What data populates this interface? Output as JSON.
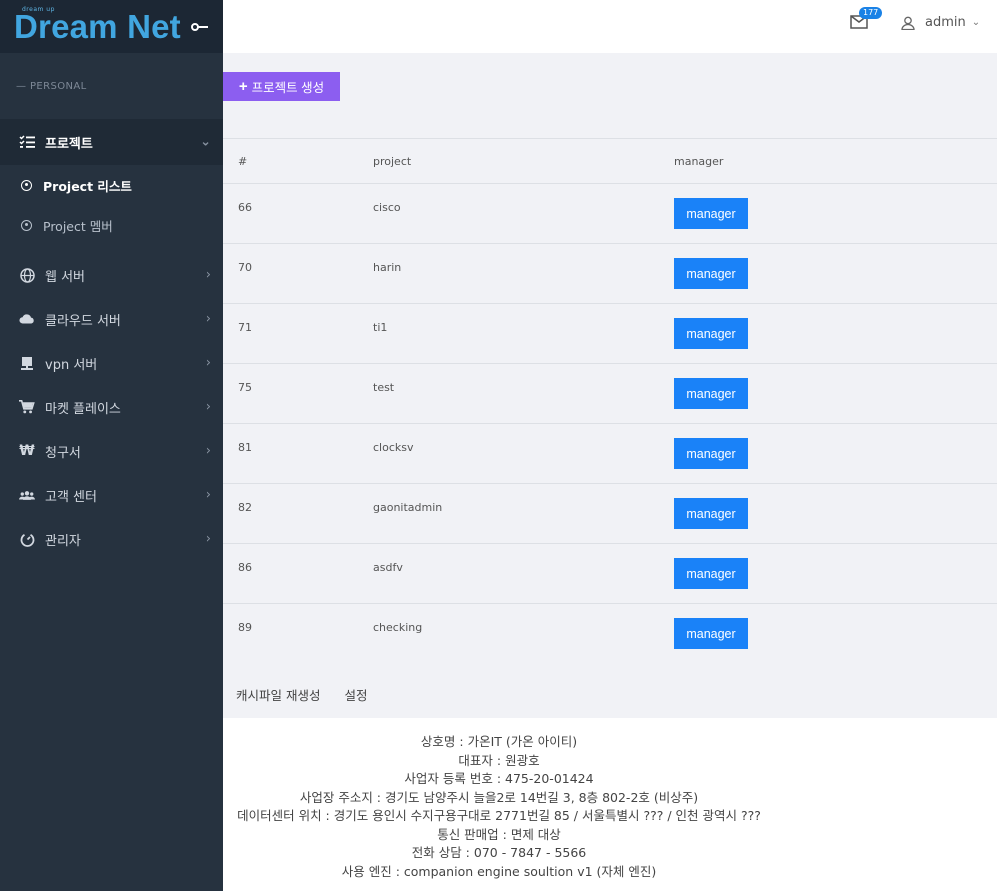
{
  "brand": {
    "tag": "dream up",
    "name": "Dream Net"
  },
  "header": {
    "mail_count": "177",
    "user_name": "admin"
  },
  "sidebar": {
    "section_label": "— PERSONAL",
    "project_menu": {
      "label": "프로젝트",
      "sub_items": [
        {
          "label": "Project 리스트"
        },
        {
          "label": "Project 멤버"
        }
      ]
    },
    "items": [
      {
        "label": "웹 서버"
      },
      {
        "label": "클라우드 서버"
      },
      {
        "label": "vpn 서버"
      },
      {
        "label": "마켓 플레이스"
      },
      {
        "label": "청구서"
      },
      {
        "label": "고객 센터"
      },
      {
        "label": "관리자"
      }
    ]
  },
  "main": {
    "create_label": "프로젝트 생성",
    "table": {
      "headers": [
        "#",
        "project",
        "manager"
      ],
      "button_label": "manager",
      "rows": [
        {
          "id": "66",
          "project": "cisco"
        },
        {
          "id": "70",
          "project": "harin"
        },
        {
          "id": "71",
          "project": "ti1"
        },
        {
          "id": "75",
          "project": "test"
        },
        {
          "id": "81",
          "project": "clocksv"
        },
        {
          "id": "82",
          "project": "gaonitadmin"
        },
        {
          "id": "86",
          "project": "asdfv"
        },
        {
          "id": "89",
          "project": "checking"
        }
      ]
    },
    "links": [
      "캐시파일 재생성",
      "설정"
    ]
  },
  "footer": {
    "lines": [
      "상호명 : 가온IT (가온 아이티)",
      "대표자 : 원광호",
      "사업자 등록 번호 : 475-20-01424",
      "사업장 주소지 : 경기도 남양주시 늘을2로 14번길 3, 8층 802-2호 (비상주)",
      "데이터센터 위치 : 경기도 용인시 수지구용구대로 2771번길 85 / 서울특별시 ??? / 인천 광역시 ???",
      "통신 판매업 : 면제 대상",
      "전화 상담 : 070 - 7847 - 5566",
      "사용 엔진 : companion engine soultion v1 (자체 엔진)"
    ]
  },
  "colors": {
    "sidebar_bg": "#26323f",
    "brand_blue": "#41a6e0",
    "create_button": "#8c5ef0",
    "manager_button": "#1a82f8",
    "badge": "#1a82e6"
  }
}
